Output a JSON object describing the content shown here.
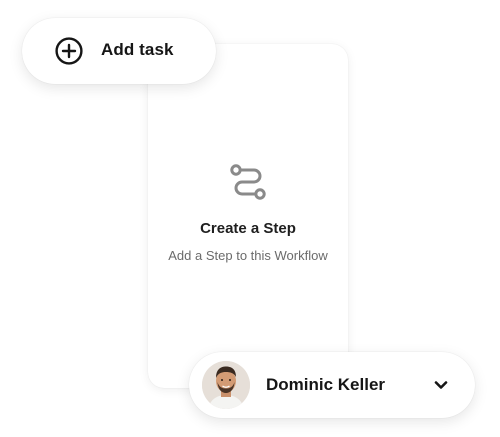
{
  "add_task": {
    "label": "Add task",
    "icon": "plus-circle-icon"
  },
  "step_card": {
    "icon": "route-icon",
    "title": "Create a Step",
    "subtitle": "Add a Step to this Workflow"
  },
  "user": {
    "name": "Dominic Keller",
    "avatar": "avatar",
    "menu_icon": "chevron-down-icon"
  },
  "colors": {
    "text_primary": "#161616",
    "text_secondary": "#6b6b6b",
    "icon_gray": "#8a8a8a",
    "background": "#ffffff"
  }
}
